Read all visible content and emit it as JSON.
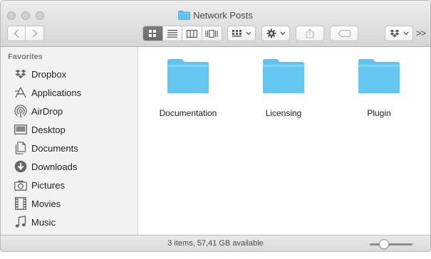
{
  "window": {
    "title": "Network Posts"
  },
  "sidebar": {
    "heading": "Favorites",
    "items": [
      {
        "label": "Dropbox",
        "icon": "dropbox-icon"
      },
      {
        "label": "Applications",
        "icon": "applications-icon"
      },
      {
        "label": "AirDrop",
        "icon": "airdrop-icon"
      },
      {
        "label": "Desktop",
        "icon": "desktop-icon"
      },
      {
        "label": "Documents",
        "icon": "documents-icon"
      },
      {
        "label": "Downloads",
        "icon": "downloads-icon"
      },
      {
        "label": "Pictures",
        "icon": "pictures-icon"
      },
      {
        "label": "Movies",
        "icon": "movies-icon"
      },
      {
        "label": "Music",
        "icon": "music-icon"
      }
    ]
  },
  "content": {
    "items": [
      {
        "name": "Documentation",
        "icon": "folder-icon"
      },
      {
        "name": "Licensing",
        "icon": "folder-icon"
      },
      {
        "name": "Plugin",
        "icon": "folder-icon"
      }
    ]
  },
  "status": {
    "text": "3 items, 57,41 GB available",
    "icon_size_level": 0.33
  },
  "toolbar": {
    "view_mode": "icon",
    "overflow_label": ">>"
  },
  "colors": {
    "folder": "#5ec3ef",
    "folder_tab": "#86d3f5",
    "active_view": "#6e6e6e"
  }
}
